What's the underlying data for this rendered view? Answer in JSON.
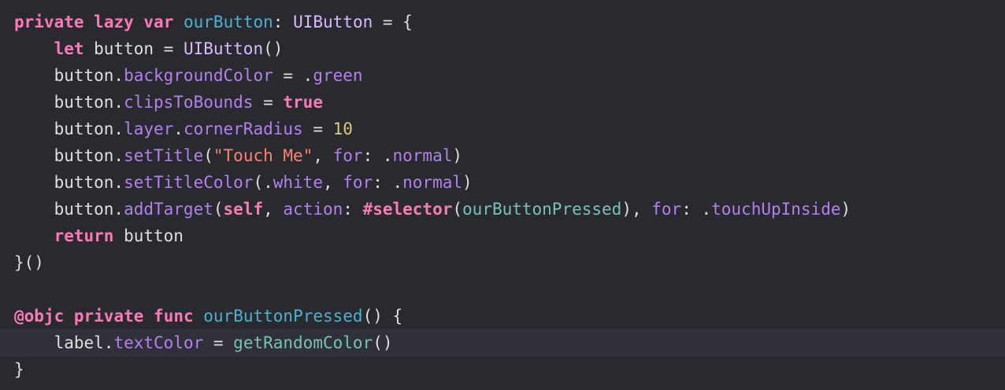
{
  "editor": {
    "colors": {
      "background": "#292a30",
      "current_line": "#2f3039",
      "plain": "#dfdfe0",
      "keyword": "#ff7ab2",
      "type": "#dabaff",
      "declaration": "#4eb0cc",
      "member": "#b281eb",
      "string": "#ff8170",
      "number": "#d9c97c",
      "project": "#78c2b3"
    },
    "lines": [
      {
        "tokens": [
          {
            "t": "private",
            "c": "keyword"
          },
          {
            "t": " ",
            "c": "plain"
          },
          {
            "t": "lazy",
            "c": "keyword"
          },
          {
            "t": " ",
            "c": "plain"
          },
          {
            "t": "var",
            "c": "keyword"
          },
          {
            "t": " ",
            "c": "plain"
          },
          {
            "t": "ourButton",
            "c": "decl"
          },
          {
            "t": ": ",
            "c": "plain"
          },
          {
            "t": "UIButton",
            "c": "type"
          },
          {
            "t": " = {",
            "c": "plain"
          }
        ]
      },
      {
        "tokens": [
          {
            "t": "    ",
            "c": "plain"
          },
          {
            "t": "let",
            "c": "keyword"
          },
          {
            "t": " button = ",
            "c": "plain"
          },
          {
            "t": "UIButton",
            "c": "type"
          },
          {
            "t": "()",
            "c": "plain"
          }
        ]
      },
      {
        "tokens": [
          {
            "t": "    button.",
            "c": "plain"
          },
          {
            "t": "backgroundColor",
            "c": "member"
          },
          {
            "t": " = .",
            "c": "plain"
          },
          {
            "t": "green",
            "c": "member"
          }
        ]
      },
      {
        "tokens": [
          {
            "t": "    button.",
            "c": "plain"
          },
          {
            "t": "clipsToBounds",
            "c": "member"
          },
          {
            "t": " = ",
            "c": "plain"
          },
          {
            "t": "true",
            "c": "keyword"
          }
        ]
      },
      {
        "tokens": [
          {
            "t": "    button.",
            "c": "plain"
          },
          {
            "t": "layer",
            "c": "member"
          },
          {
            "t": ".",
            "c": "plain"
          },
          {
            "t": "cornerRadius",
            "c": "member"
          },
          {
            "t": " = ",
            "c": "plain"
          },
          {
            "t": "10",
            "c": "number"
          }
        ]
      },
      {
        "tokens": [
          {
            "t": "    button.",
            "c": "plain"
          },
          {
            "t": "setTitle",
            "c": "member"
          },
          {
            "t": "(",
            "c": "plain"
          },
          {
            "t": "\"Touch Me\"",
            "c": "string"
          },
          {
            "t": ", ",
            "c": "plain"
          },
          {
            "t": "for",
            "c": "member"
          },
          {
            "t": ": .",
            "c": "plain"
          },
          {
            "t": "normal",
            "c": "member"
          },
          {
            "t": ")",
            "c": "plain"
          }
        ]
      },
      {
        "tokens": [
          {
            "t": "    button.",
            "c": "plain"
          },
          {
            "t": "setTitleColor",
            "c": "member"
          },
          {
            "t": "(.",
            "c": "plain"
          },
          {
            "t": "white",
            "c": "member"
          },
          {
            "t": ", ",
            "c": "plain"
          },
          {
            "t": "for",
            "c": "member"
          },
          {
            "t": ": .",
            "c": "plain"
          },
          {
            "t": "normal",
            "c": "member"
          },
          {
            "t": ")",
            "c": "plain"
          }
        ]
      },
      {
        "tokens": [
          {
            "t": "    button.",
            "c": "plain"
          },
          {
            "t": "addTarget",
            "c": "member"
          },
          {
            "t": "(",
            "c": "plain"
          },
          {
            "t": "self",
            "c": "keyword"
          },
          {
            "t": ", ",
            "c": "plain"
          },
          {
            "t": "action",
            "c": "member"
          },
          {
            "t": ": ",
            "c": "plain"
          },
          {
            "t": "#selector",
            "c": "keyword"
          },
          {
            "t": "(",
            "c": "plain"
          },
          {
            "t": "ourButtonPressed",
            "c": "project"
          },
          {
            "t": "), ",
            "c": "plain"
          },
          {
            "t": "for",
            "c": "member"
          },
          {
            "t": ": .",
            "c": "plain"
          },
          {
            "t": "touchUpInside",
            "c": "member"
          },
          {
            "t": ")",
            "c": "plain"
          }
        ]
      },
      {
        "tokens": [
          {
            "t": "    ",
            "c": "plain"
          },
          {
            "t": "return",
            "c": "keyword"
          },
          {
            "t": " button",
            "c": "plain"
          }
        ]
      },
      {
        "tokens": [
          {
            "t": "}()",
            "c": "plain"
          }
        ]
      },
      {
        "tokens": []
      },
      {
        "tokens": [
          {
            "t": "@objc",
            "c": "keyword"
          },
          {
            "t": " ",
            "c": "plain"
          },
          {
            "t": "private",
            "c": "keyword"
          },
          {
            "t": " ",
            "c": "plain"
          },
          {
            "t": "func",
            "c": "keyword"
          },
          {
            "t": " ",
            "c": "plain"
          },
          {
            "t": "ourButtonPressed",
            "c": "decl"
          },
          {
            "t": "() {",
            "c": "plain"
          }
        ]
      },
      {
        "current": true,
        "tokens": [
          {
            "t": "    label.",
            "c": "plain"
          },
          {
            "t": "textColor",
            "c": "member"
          },
          {
            "t": " = ",
            "c": "plain"
          },
          {
            "t": "getRandomColor",
            "c": "project"
          },
          {
            "t": "()",
            "c": "plain"
          }
        ]
      },
      {
        "tokens": [
          {
            "t": "}",
            "c": "plain"
          }
        ]
      }
    ]
  }
}
